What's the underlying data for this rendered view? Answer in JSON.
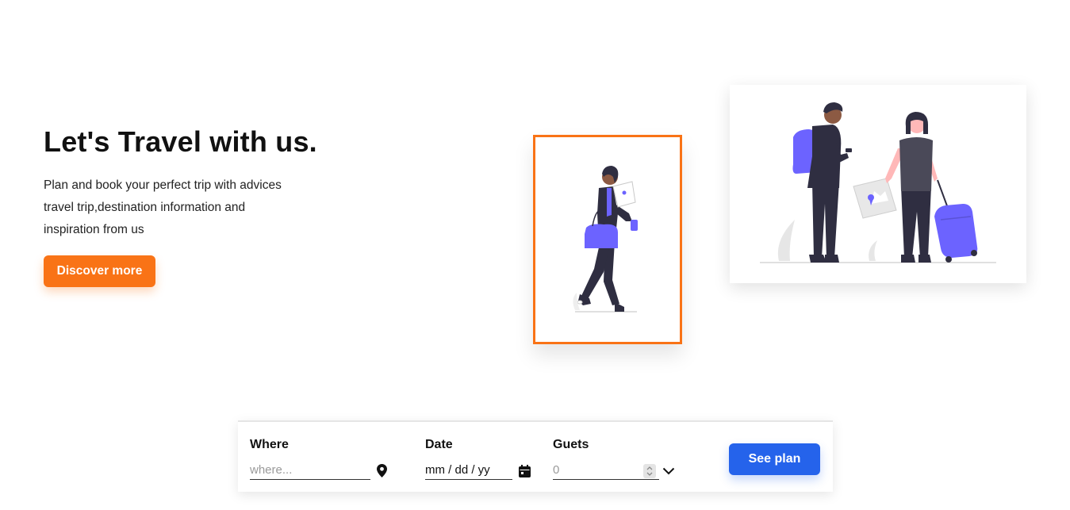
{
  "hero": {
    "title": "Let's Travel with us.",
    "description": "Plan and book your perfect trip with advices travel trip,destination information and inspiration from us",
    "cta_label": "Discover more"
  },
  "illustrations": {
    "traveler_woman": "traveler-walking-illustration",
    "traveler_couple": "travelers-with-luggage-illustration"
  },
  "search": {
    "where": {
      "label": "Where",
      "placeholder": "where...",
      "icon": "location-pin-icon"
    },
    "date": {
      "label": "Date",
      "value": "mm / dd / yy",
      "icon": "calendar-icon"
    },
    "guests": {
      "label": "Guets",
      "placeholder": "0",
      "icon": "chevron-down-icon"
    },
    "submit_label": "See plan"
  },
  "colors": {
    "accent_orange": "#f97316",
    "accent_blue": "#2563eb",
    "illustration_purple": "#6c63ff",
    "illustration_dark": "#2f2e41"
  }
}
